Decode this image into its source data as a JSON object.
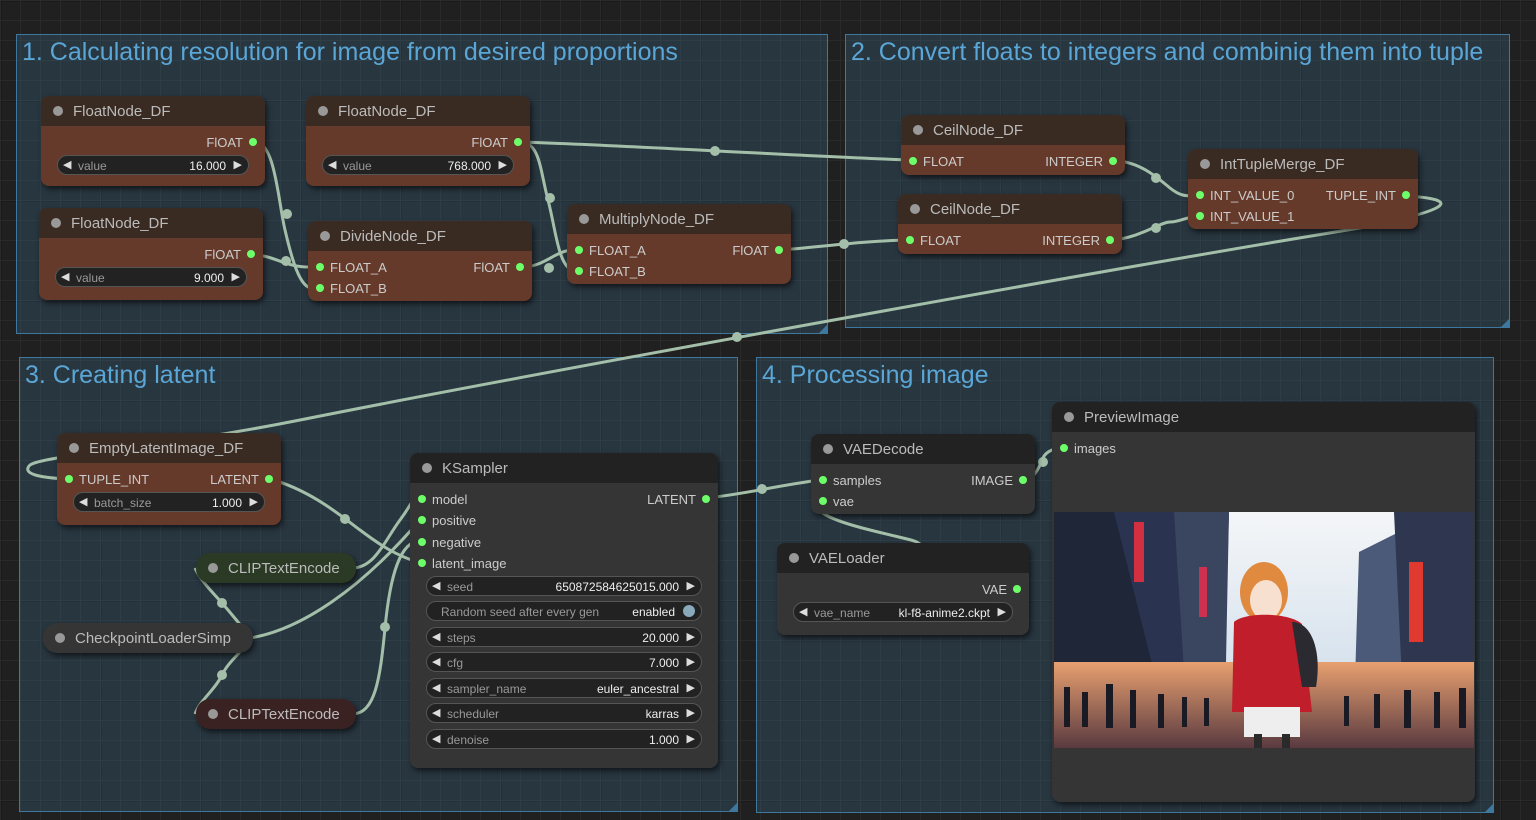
{
  "groups": {
    "g1": "1. Calculating resolution for image from desired proportions",
    "g2": "2. Convert floats to integers and combinig them into tuple",
    "g3": "3. Creating latent",
    "g4": "4. Processing image"
  },
  "float1": {
    "title": "FloatNode_DF",
    "out": "FlOAT",
    "w_label": "value",
    "w_value": "16.000"
  },
  "float2": {
    "title": "FloatNode_DF",
    "out": "FlOAT",
    "w_label": "value",
    "w_value": "768.000"
  },
  "float3": {
    "title": "FloatNode_DF",
    "out": "FlOAT",
    "w_label": "value",
    "w_value": "9.000"
  },
  "divide": {
    "title": "DivideNode_DF",
    "in_a": "FLOAT_A",
    "in_b": "FLOAT_B",
    "out": "FlOAT"
  },
  "multiply": {
    "title": "MultiplyNode_DF",
    "in_a": "FLOAT_A",
    "in_b": "FLOAT_B",
    "out": "FlOAT"
  },
  "ceil1": {
    "title": "CeilNode_DF",
    "in": "FLOAT",
    "out": "INTEGER"
  },
  "ceil2": {
    "title": "CeilNode_DF",
    "in": "FLOAT",
    "out": "INTEGER"
  },
  "tuple": {
    "title": "IntTupleMerge_DF",
    "in_0": "INT_VALUE_0",
    "in_1": "INT_VALUE_1",
    "out": "TUPLE_INT"
  },
  "latent": {
    "title": "EmptyLatentImage_DF",
    "in": "TUPLE_INT",
    "out": "LATENT",
    "w_label": "batch_size",
    "w_value": "1.000"
  },
  "clip1": {
    "title": "CLIPTextEncode"
  },
  "clip2": {
    "title": "CLIPTextEncode"
  },
  "ckpt": {
    "title": "CheckpointLoaderSimp"
  },
  "ksampler": {
    "title": "KSampler",
    "inputs": [
      "model",
      "positive",
      "negative",
      "latent_image"
    ],
    "out": "LATENT",
    "seed": {
      "label": "seed",
      "value": "650872584625015.000"
    },
    "seed_mode": {
      "label": "Random seed after every gen",
      "value": "enabled"
    },
    "steps": {
      "label": "steps",
      "value": "20.000"
    },
    "cfg": {
      "label": "cfg",
      "value": "7.000"
    },
    "sampler": {
      "label": "sampler_name",
      "value": "euler_ancestral"
    },
    "scheduler": {
      "label": "scheduler",
      "value": "karras"
    },
    "denoise": {
      "label": "denoise",
      "value": "1.000"
    }
  },
  "vaedecode": {
    "title": "VAEDecode",
    "in_samples": "samples",
    "in_vae": "vae",
    "out": "IMAGE"
  },
  "vaeloader": {
    "title": "VAELoader",
    "out": "VAE",
    "w_label": "vae_name",
    "w_value": "kl-f8-anime2.ckpt"
  },
  "preview": {
    "title": "PreviewImage",
    "in": "images"
  },
  "colors": {
    "wire": "#a4bfa9",
    "slot": "#6dff6a",
    "group": "#3f789e",
    "node": "#353535",
    "node_brown": "#653a2a",
    "clip_green": "#2a3a24",
    "clip_red": "#3a2222"
  }
}
